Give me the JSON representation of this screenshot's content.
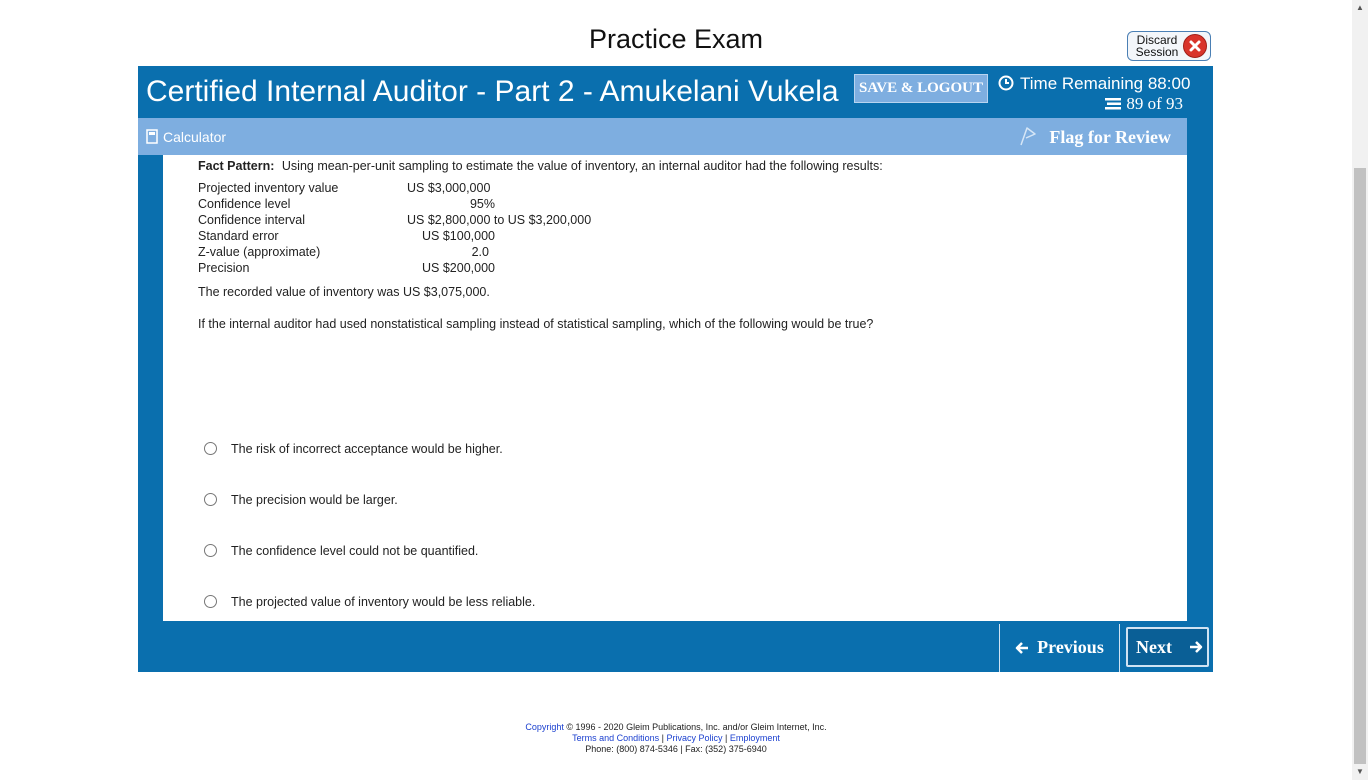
{
  "page": {
    "title": "Practice Exam"
  },
  "discard": {
    "line1": "Discard",
    "line2": "Session"
  },
  "header": {
    "exam_title": "Certified Internal Auditor - Part 2 - Amukelani Vukela",
    "save_logout": "SAVE & LOGOUT",
    "time_remaining": "Time Remaining 88:00",
    "progress": "89 of 93"
  },
  "toolbar": {
    "calculator": "Calculator",
    "flag_for_review": "Flag for Review"
  },
  "question": {
    "fact_label": "Fact Pattern:",
    "fact_text": "Using mean-per-unit sampling to estimate the value of inventory, an internal auditor had the following results:",
    "results": [
      {
        "label": "Projected inventory value",
        "value": "US $3,000,000"
      },
      {
        "label": "Confidence level",
        "value": "95%"
      },
      {
        "label": "Confidence interval",
        "value": "US $2,800,000 to US $3,200,000"
      },
      {
        "label": "Standard error",
        "value": "US $100,000"
      },
      {
        "label": "Z-value (approximate)",
        "value": "2.0"
      },
      {
        "label": "Precision",
        "value": "US $200,000"
      }
    ],
    "recorded": "The recorded value of inventory was US $3,075,000.",
    "prompt": "If the internal auditor had used nonstatistical sampling instead of statistical sampling, which of the following would be true?",
    "options": [
      "The risk of incorrect acceptance would be higher.",
      "The precision would be larger.",
      "The confidence level could not be quantified.",
      "The projected value of inventory would be less reliable."
    ],
    "selected": null
  },
  "navigation": {
    "previous": "Previous",
    "next": "Next"
  },
  "footer": {
    "copyright_link": "Copyright",
    "copyright_text": "© 1996 - 2020 Gleim Publications, Inc. and/or Gleim Internet, Inc.",
    "terms": "Terms and Conditions",
    "privacy": "Privacy Policy",
    "employment": "Employment",
    "sep": "|",
    "phone": "Phone: (800) 874-5346 | Fax: (352) 375-6940"
  },
  "colors": {
    "primary": "#0a6fae",
    "toolbar": "#7eaee0",
    "discard_red": "#d9342b"
  }
}
